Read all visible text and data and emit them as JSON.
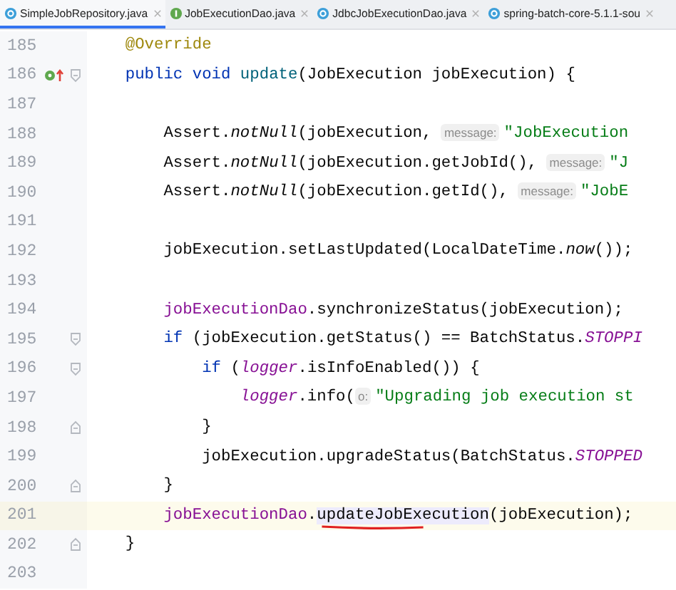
{
  "tabs": [
    {
      "label": "SimpleJobRepository.java",
      "kind": "class",
      "selected": true
    },
    {
      "label": "JobExecutionDao.java",
      "kind": "interface",
      "selected": false
    },
    {
      "label": "JdbcJobExecutionDao.java",
      "kind": "class",
      "selected": false
    },
    {
      "label": "spring-batch-core-5.1.1-sou",
      "kind": "class",
      "selected": false
    }
  ],
  "editor": {
    "lines": [
      {
        "number": "185",
        "current": false,
        "tokens": [
          {
            "kind": "annotation",
            "text": "    @Override"
          }
        ]
      },
      {
        "number": "186",
        "current": false,
        "override_marker": true,
        "fold_start": true,
        "tokens": [
          {
            "kind": "keyword",
            "text": "    public void "
          },
          {
            "kind": "decl",
            "text": "update"
          },
          {
            "kind": "plain",
            "text": "(JobExecution jobExecution) {"
          }
        ]
      },
      {
        "number": "187",
        "current": false
      },
      {
        "number": "188",
        "current": false,
        "tokens": [
          {
            "kind": "plain",
            "text": "        Assert."
          },
          {
            "kind": "static",
            "text": "notNull"
          },
          {
            "kind": "plain",
            "text": "(jobExecution, "
          },
          {
            "kind": "hint",
            "text": "message:"
          },
          {
            "kind": "string",
            "text": "\"JobExecution"
          }
        ]
      },
      {
        "number": "189",
        "current": false,
        "tokens": [
          {
            "kind": "plain",
            "text": "        Assert."
          },
          {
            "kind": "static",
            "text": "notNull"
          },
          {
            "kind": "plain",
            "text": "(jobExecution.getJobId(), "
          },
          {
            "kind": "hint",
            "text": "message:"
          },
          {
            "kind": "string",
            "text": "\"J"
          }
        ]
      },
      {
        "number": "190",
        "current": false,
        "tokens": [
          {
            "kind": "plain",
            "text": "        Assert."
          },
          {
            "kind": "static",
            "text": "notNull"
          },
          {
            "kind": "plain",
            "text": "(jobExecution.getId(), "
          },
          {
            "kind": "hint",
            "text": "message:"
          },
          {
            "kind": "string",
            "text": "\"JobE"
          }
        ]
      },
      {
        "number": "191",
        "current": false
      },
      {
        "number": "192",
        "current": false,
        "tokens": [
          {
            "kind": "plain",
            "text": "        jobExecution.setLastUpdated(LocalDateTime."
          },
          {
            "kind": "static",
            "text": "now"
          },
          {
            "kind": "plain",
            "text": "());"
          }
        ]
      },
      {
        "number": "193",
        "current": false
      },
      {
        "number": "194",
        "current": false,
        "tokens": [
          {
            "kind": "field",
            "text": "        jobExecutionDao"
          },
          {
            "kind": "plain",
            "text": ".synchronizeStatus(jobExecution);"
          }
        ]
      },
      {
        "number": "195",
        "current": false,
        "fold_start": true,
        "tokens": [
          {
            "kind": "keyword",
            "text": "        if"
          },
          {
            "kind": "plain",
            "text": " (jobExecution.getStatus() == BatchStatus."
          },
          {
            "kind": "constant",
            "text": "STOPPI"
          }
        ]
      },
      {
        "number": "196",
        "current": false,
        "fold_start": true,
        "tokens": [
          {
            "kind": "keyword",
            "text": "            if"
          },
          {
            "kind": "plain",
            "text": " ("
          },
          {
            "kind": "logger",
            "text": "logger"
          },
          {
            "kind": "plain",
            "text": ".isInfoEnabled()) {"
          }
        ]
      },
      {
        "number": "197",
        "current": false,
        "tokens": [
          {
            "kind": "logger",
            "text": "                logger"
          },
          {
            "kind": "plain",
            "text": ".info("
          },
          {
            "kind": "hint",
            "text": "o:"
          },
          {
            "kind": "string",
            "text": "\"Upgrading job execution st"
          }
        ]
      },
      {
        "number": "198",
        "current": false,
        "fold_end": true,
        "tokens": [
          {
            "kind": "plain",
            "text": "            }"
          }
        ]
      },
      {
        "number": "199",
        "current": false,
        "tokens": [
          {
            "kind": "plain",
            "text": "            jobExecution.upgradeStatus(BatchStatus."
          },
          {
            "kind": "constant",
            "text": "STOPPED"
          }
        ]
      },
      {
        "number": "200",
        "current": false,
        "fold_end": true,
        "tokens": [
          {
            "kind": "plain",
            "text": "        }"
          }
        ]
      },
      {
        "number": "201",
        "current": true,
        "tokens": [
          {
            "kind": "field",
            "text": "        jobExecutionDao"
          },
          {
            "kind": "plain",
            "text": "."
          },
          {
            "kind": "usage",
            "text": "updateJobExecution",
            "underlined": true
          },
          {
            "kind": "plain",
            "text": "(jobExecution);"
          }
        ]
      },
      {
        "number": "202",
        "current": false,
        "fold_end": true,
        "tokens": [
          {
            "kind": "plain",
            "text": "    }"
          }
        ]
      },
      {
        "number": "203",
        "current": false
      }
    ]
  }
}
